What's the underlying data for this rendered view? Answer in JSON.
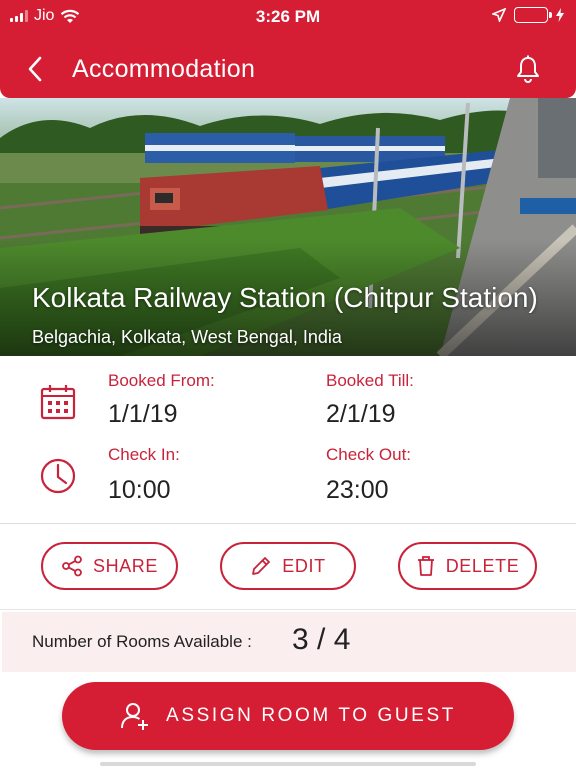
{
  "status_bar": {
    "carrier": "Jio",
    "time": "3:26 PM"
  },
  "header": {
    "title": "Accommodation"
  },
  "hero": {
    "station_name": "Kolkata Railway Station (Chitpur Station)",
    "location": "Belgachia, Kolkata, West Bengal, India"
  },
  "booking": {
    "booked_from_label": "Booked From:",
    "booked_from_value": "1/1/19",
    "booked_till_label": "Booked Till:",
    "booked_till_value": "2/1/19",
    "check_in_label": "Check In:",
    "check_in_value": "10:00",
    "check_out_label": "Check Out:",
    "check_out_value": "23:00"
  },
  "actions": {
    "share_label": "SHARE",
    "edit_label": "EDIT",
    "delete_label": "DELETE"
  },
  "rooms": {
    "label": "Number of Rooms Available :",
    "count": "3 / 4"
  },
  "cta": {
    "label": "ASSIGN ROOM TO GUEST"
  },
  "colors": {
    "brand": "#d51d33",
    "accent_text": "#c8233a",
    "rooms_bg": "#fbeeee",
    "battery": "#4cd964"
  },
  "icons": [
    "signal-icon",
    "wifi-icon",
    "location-arrow-icon",
    "battery-icon",
    "back-chevron-icon",
    "bell-icon",
    "calendar-icon",
    "clock-icon",
    "share-icon",
    "edit-pencil-icon",
    "trash-icon",
    "add-user-icon"
  ]
}
